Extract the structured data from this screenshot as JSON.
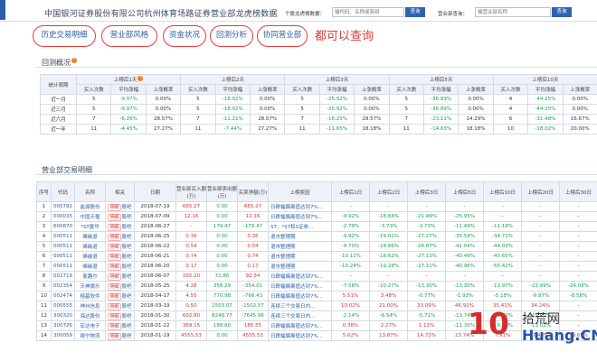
{
  "header": {
    "title": "中国银河证券股份有限公司杭州体育场路证券营业部龙虎榜数据",
    "stock_label": "个股龙虎榜数据：",
    "stock_placeholder": "输代码、名称或简拼",
    "query_label": "查询",
    "dept_label": "营业部查询：",
    "dept_placeholder": "输营业部名称"
  },
  "tabs": [
    "历史交易明细",
    "营业部风格",
    "资金状况",
    "回测分析",
    "协同营业部"
  ],
  "annotation": "都可以查询",
  "backtest": {
    "title": "回测概况",
    "period_header": "统计周期",
    "groups": [
      "上榜后1天",
      "上榜后2天",
      "上榜后3天",
      "上榜后5天",
      "上榜后10天"
    ],
    "subheaders": [
      "买入次数",
      "平均涨幅",
      "上涨概率"
    ],
    "rows": [
      {
        "period": "近一月",
        "cells": [
          "5",
          "-9.97%",
          "0.00%",
          "5",
          "-18.92%",
          "0.00%",
          "5",
          "-25.92%",
          "0.00%",
          "5",
          "-36.89%",
          "0.00%",
          "4",
          "-44.25%",
          "0.00%"
        ]
      },
      {
        "period": "近三月",
        "cells": [
          "5",
          "-9.97%",
          "0.00%",
          "5",
          "-18.92%",
          "0.00%",
          "5",
          "-25.92%",
          "0.00%",
          "5",
          "-36.89%",
          "0.00%",
          "4",
          "-44.25%",
          "0.00%"
        ]
      },
      {
        "period": "近六月",
        "cells": [
          "7",
          "-6.26%",
          "28.57%",
          "7",
          "-11.21%",
          "28.57%",
          "7",
          "-16.25%",
          "28.57%",
          "7",
          "-23.11%",
          "14.29%",
          "6",
          "-31.48%",
          "16.67%"
        ]
      },
      {
        "period": "近一年",
        "cells": [
          "11",
          "-4.45%",
          "27.27%",
          "11",
          "-7.44%",
          "27.27%",
          "11",
          "-11.65%",
          "18.18%",
          "11",
          "-14.63%",
          "18.18%",
          "10",
          "-18.02%",
          "20.00%"
        ]
      }
    ]
  },
  "detail": {
    "title": "营业部交易明细",
    "headers": [
      "序号",
      "代码",
      "名称",
      "相关",
      "日期",
      "营业部买入额(万)",
      "营业部卖出额(万)",
      "买卖净额(万)",
      "上榜原因",
      "上榜后1日",
      "上榜后2日",
      "上榜后3日",
      "上榜后5日",
      "上榜后10日",
      "上榜后20日",
      "上榜后30日"
    ],
    "tag_label": "明细",
    "tag_label2": "股吧",
    "rows": [
      [
        "1",
        "000792",
        "盐湖股份",
        "2018-07-19",
        "665.27",
        "0.00",
        "665.27",
        "日跌幅偏离值达到7%...",
        "-",
        "-",
        "-",
        "-",
        "-",
        "-",
        "-"
      ],
      [
        "2",
        "000035",
        "中国天楹",
        "2018-07-09",
        "12.16",
        "0.00",
        "12.16",
        "日跌幅偏离值达到7%...",
        "-9.92%",
        "-18.84%",
        "-21.49%",
        "-25.95%",
        "-",
        "-",
        "-"
      ],
      [
        "3",
        "600870",
        "*ST厦华",
        "2018-06-27",
        "-",
        "179.47",
        "-179.47",
        "ST、*ST和S证券...",
        "-2.79%",
        "-3.73%",
        "-3.73%",
        "-11.49%",
        "-11.18%",
        "-",
        "-"
      ],
      [
        "4",
        "000511",
        "烯碳退",
        "2018-06-25",
        "0.36",
        "0.00",
        "0.36",
        "退市整理期",
        "-9.92%",
        "-19.01%",
        "-27.27%",
        "-35.54%",
        "-34.71%",
        "-",
        "-"
      ],
      [
        "5",
        "000511",
        "烯碳退",
        "2018-06-22",
        "0.54",
        "0.00",
        "0.54",
        "退市整理期",
        "-9.70%",
        "-18.66%",
        "-26.87%",
        "-41.04%",
        "-44.03%",
        "-",
        "-"
      ],
      [
        "6",
        "000511",
        "烯碳退",
        "2018-06-21",
        "0.74",
        "0.00",
        "0.74",
        "退市整理期",
        "-10.12%",
        "-18.62%",
        "-27.13%",
        "-40.49%",
        "-47.65%",
        "-",
        "-"
      ],
      [
        "7",
        "000511",
        "烯碳退",
        "2018-06-20",
        "0.17",
        "0.00",
        "0.17",
        "退市整理期",
        "-10.24%",
        "-19.28%",
        "-27.11%",
        "-40.96%",
        "-55.42%",
        "-",
        "-"
      ],
      [
        "8",
        "002719",
        "麦趣尔",
        "2018-06-07",
        "165.20",
        "72.86",
        "92.34",
        "日跌幅偏离值达到7%...",
        "-",
        "-",
        "-",
        "-",
        "-",
        "-",
        "-"
      ],
      [
        "9",
        "002354",
        "天神娱乐",
        "2018-05-25",
        "4.28",
        "358.29",
        "-354.01",
        "日跌幅偏离值达到7%...",
        "-7.58%",
        "-10.27%",
        "-13.30%",
        "-13.30%",
        "-13.97%",
        "-23.99%",
        "-24.08%"
      ],
      [
        "10",
        "002474",
        "榕基软件",
        "2018-04-17",
        "4.55",
        "770.98",
        "-766.43",
        "日跌幅偏离值达到7%...",
        "5.51%",
        "3.48%",
        "-0.77%",
        "-1.93%",
        "-5.18%",
        "-9.87%",
        "-8.58%"
      ],
      [
        "11",
        "000555",
        "神州信息",
        "2018-03-19",
        "0.50",
        "1503.07",
        "-1502.57",
        "连续三个交易日内...",
        "10.02%",
        "21.00%",
        "33.09%",
        "46.91%",
        "35.41%",
        "34.24%",
        "-"
      ],
      [
        "12",
        "300320",
        "海达股份",
        "2018-01-30",
        "602.80",
        "8248.77",
        "-7645.96",
        "连续三个交易日内...",
        "-2.14%",
        "-6.54%",
        "-5.71%",
        "-13.74%",
        "-12.92%",
        "-19.21%",
        "-"
      ],
      [
        "13",
        "300726",
        "宏达电子",
        "2018-01-22",
        "369.15",
        "188.60",
        "180.55",
        "日跌幅偏离值达到7%...",
        "0.38%",
        "2.27%",
        "1.12%",
        "-11.30%",
        "-16.60%",
        "-13.02%",
        "-"
      ],
      [
        "14",
        "300059",
        "赣宁物流",
        "2018-01-19",
        "4555.53",
        "0.00",
        "4555.53",
        "日跌幅偏离值达到7%...",
        "5.62%",
        "13.87%",
        "14.72%",
        "23.74%",
        "7.91%",
        "7.40%",
        "19.65%"
      ]
    ]
  },
  "watermark": {
    "ten": "10",
    "cn": "拾荒网",
    "en": "Huang.CN"
  },
  "colors": {
    "accent": "#2f63b2",
    "red": "#e0302e",
    "green": "#16a24a",
    "circle": "#e23b3b"
  }
}
